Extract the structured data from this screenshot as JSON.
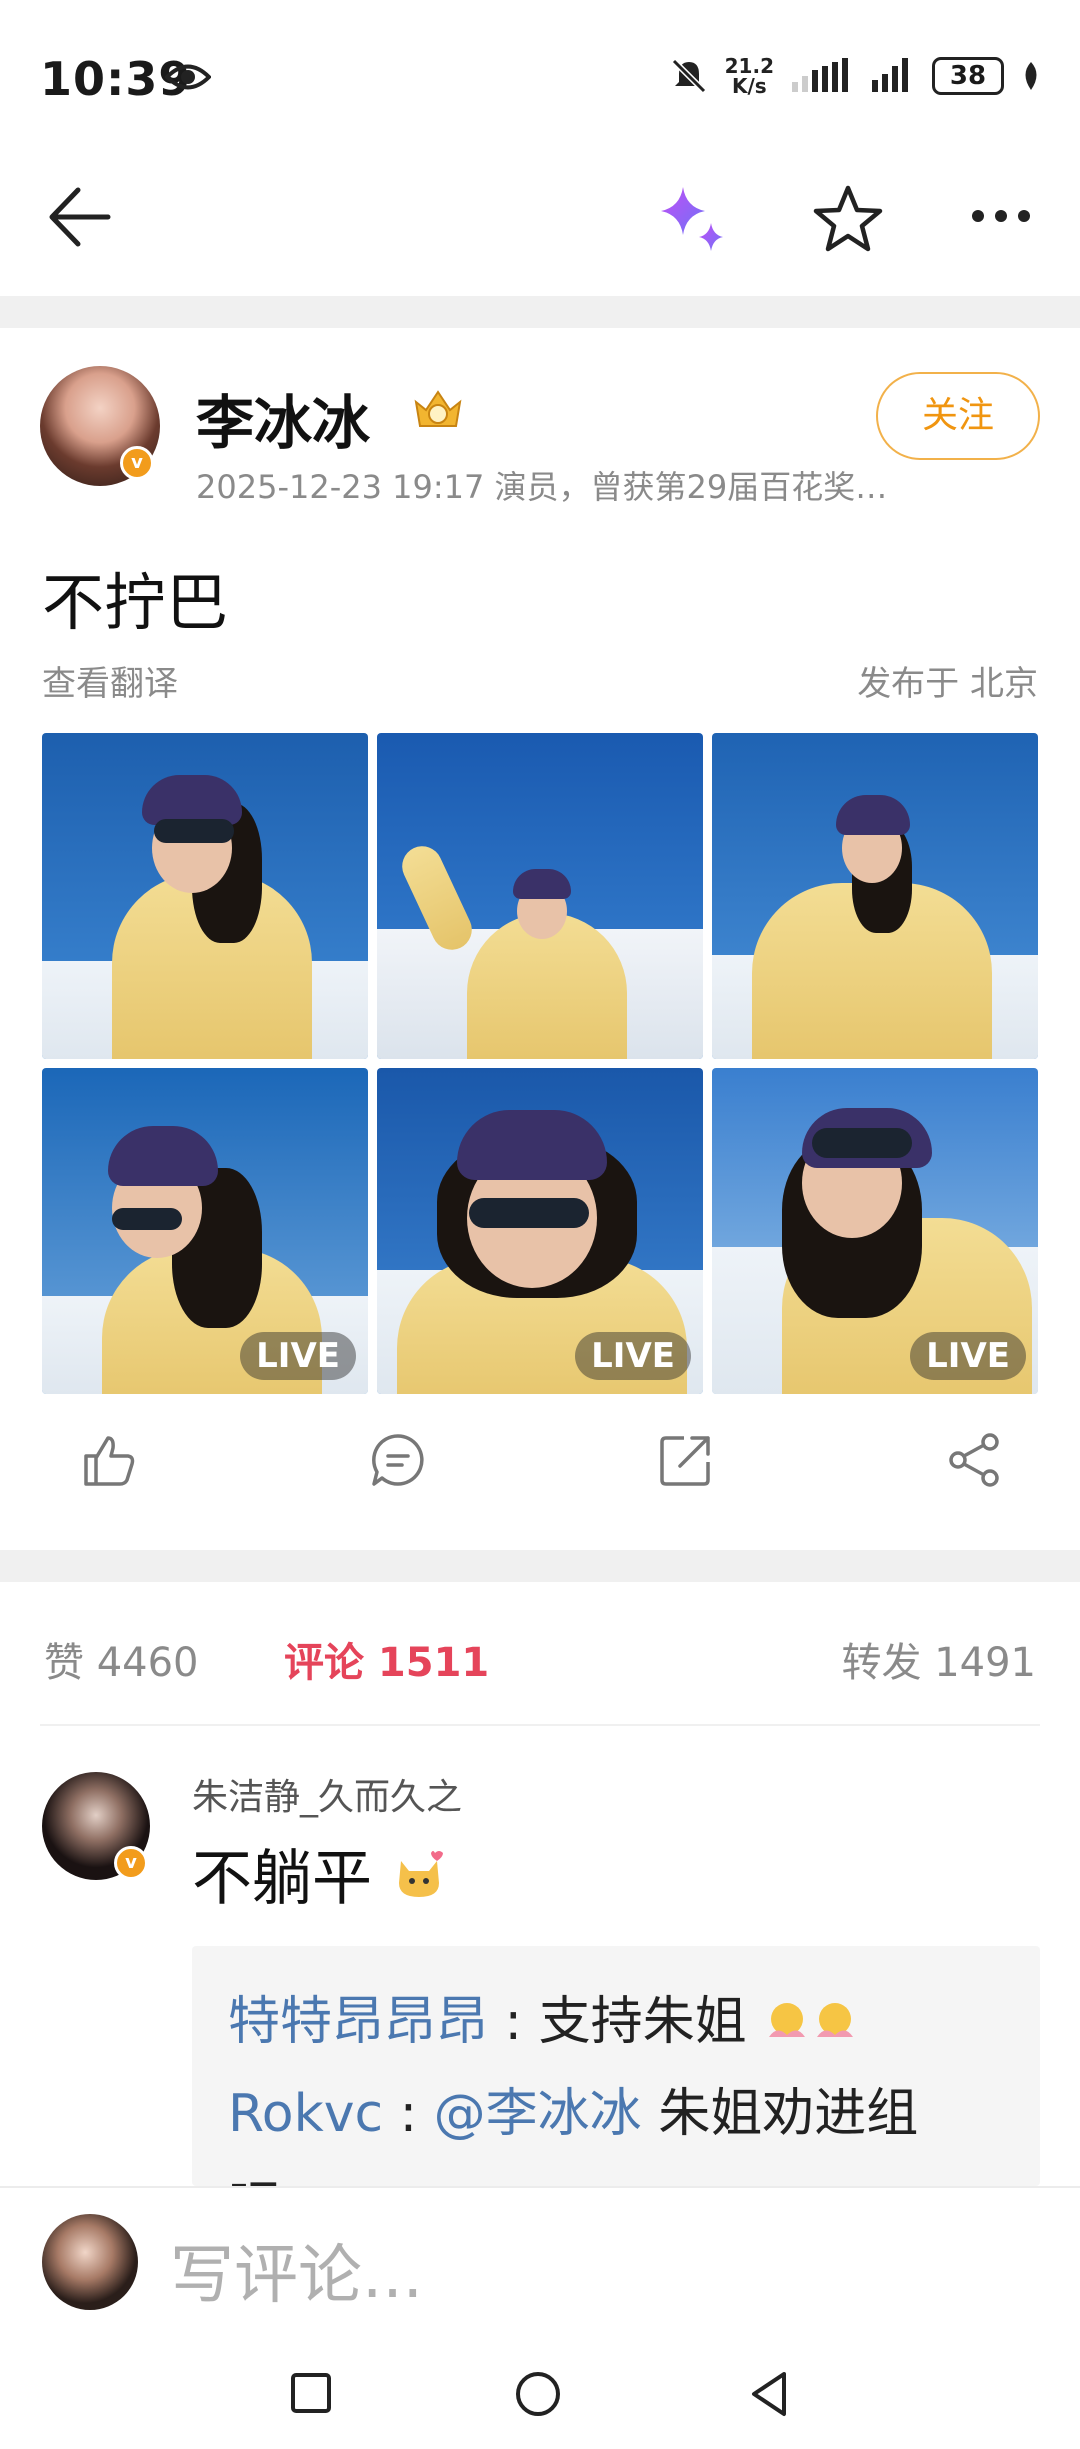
{
  "status_bar": {
    "time": "10:39",
    "net_speed_value": "21.2",
    "net_speed_unit": "K/s",
    "battery": "38"
  },
  "post": {
    "author": "李冰冰",
    "meta": "2025-12-23 19:17  演员，曾获第29届百花奖…",
    "follow_label": "关注",
    "text": "不拧巴",
    "translate_label": "查看翻译",
    "location": "发布于 北京",
    "verified_mark": "v",
    "photos": [
      {
        "live": ""
      },
      {
        "live": ""
      },
      {
        "live": ""
      },
      {
        "live": "LIVE"
      },
      {
        "live": "LIVE"
      },
      {
        "live": "LIVE"
      }
    ]
  },
  "stats": {
    "likes": "赞 4460",
    "comments": "评论 1511",
    "reposts": "转发 1491"
  },
  "comment": {
    "author": "朱洁静_久而久之",
    "text": "不躺平",
    "replies": [
      {
        "user": "特特昂昂昂",
        "sep": " : ",
        "text": "支持朱姐"
      },
      {
        "user": "Rokvc",
        "sep": " : ",
        "mention": "@李冰冰",
        "text": " 朱姐劝进组"
      },
      {
        "text": "吧"
      }
    ]
  },
  "input_bar": {
    "placeholder": "写评论..."
  },
  "colors": {
    "accent_orange": "#f09510",
    "active_red": "#e5445a",
    "link_blue": "#4b78b0",
    "sparkle_purple": "#a35cf0"
  },
  "icons": [
    "eye-icon",
    "mute-icon",
    "signal-icon",
    "battery-icon",
    "leaf-icon",
    "back-arrow-icon",
    "sparkle-icon",
    "star-icon",
    "more-icon",
    "thumbs-up-icon",
    "comment-icon",
    "repost-icon",
    "share-icon",
    "square-icon",
    "circle-icon",
    "triangle-back-icon"
  ]
}
